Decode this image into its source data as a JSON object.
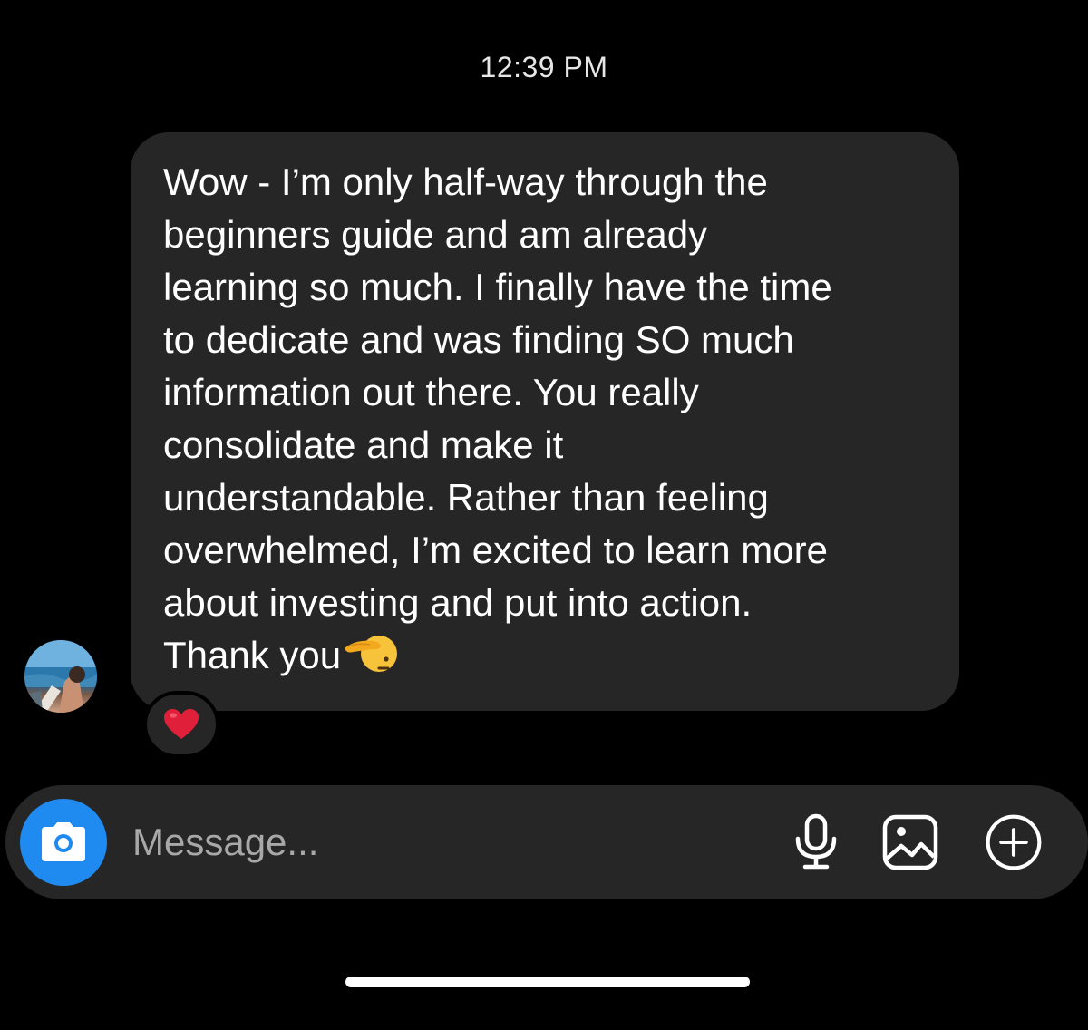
{
  "thread": {
    "timestamp": "12:39 PM"
  },
  "message": {
    "text": "Wow - I’m only half-way through the\nbeginners guide and am already\nlearning so much. I finally have the time\nto dedicate and was finding SO much\ninformation out there. You really\nconsolidate and make it\nunderstandable. Rather than feeling\noverwhelmed, I’m excited to learn more\nabout investing and put into action.\nThank you",
    "trailing_emoji": "saluting-face-emoji",
    "reaction": "red-heart-emoji"
  },
  "composer": {
    "placeholder": "Message...",
    "left_icon": "camera-icon",
    "right_icons": [
      "microphone-icon",
      "gallery-icon",
      "add-circle-icon"
    ]
  },
  "colors": {
    "background": "#000000",
    "bubble": "#262626",
    "accent": "#1f8bf0",
    "heart": "#e0203a"
  }
}
